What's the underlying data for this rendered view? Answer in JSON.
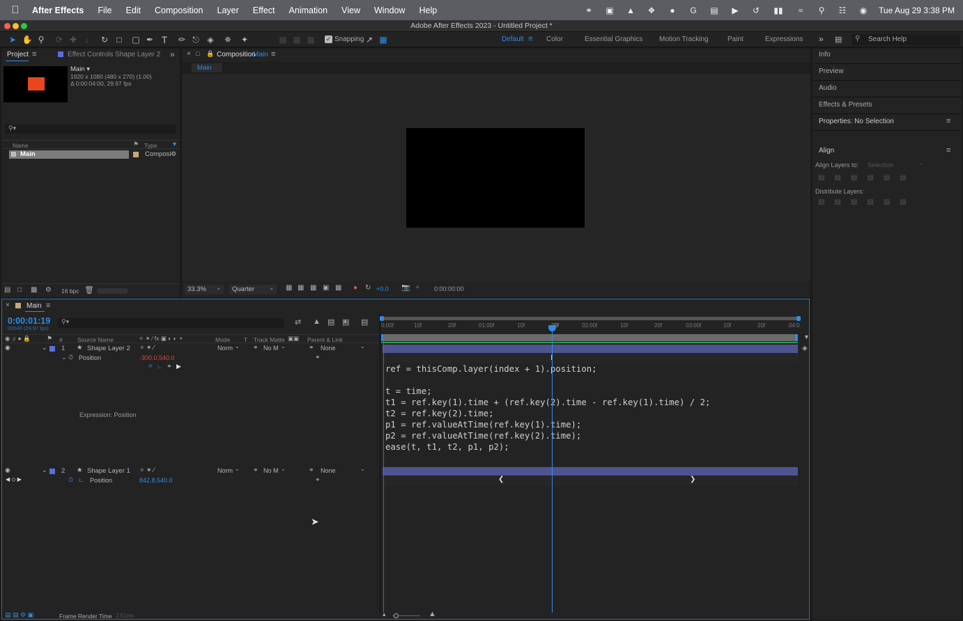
{
  "menubar": {
    "app": "After Effects",
    "items": [
      "File",
      "Edit",
      "Composition",
      "Layer",
      "Effect",
      "Animation",
      "View",
      "Window",
      "Help"
    ],
    "datetime": "Tue Aug 29  3:38 PM"
  },
  "window": {
    "title": "Adobe After Effects 2023 - Untitled Project *"
  },
  "toolbar": {
    "snapping": "Snapping",
    "workspaces": [
      "Default",
      "Color",
      "Essential Graphics",
      "Motion Tracking",
      "Paint",
      "Expressions"
    ],
    "active_workspace": "Default",
    "search_placeholder": "Search Help"
  },
  "project": {
    "tab": "Project",
    "effect_tab": "Effect Controls Shape Layer 2",
    "comp_name": "Main ▾",
    "comp_info1": "1920 x 1080  (480 x 270) (1.00)",
    "comp_info2": "Δ 0:00:04:00, 29.97 fps",
    "col_name": "Name",
    "col_type": "Type",
    "item_name": "Main",
    "item_type": "Composi",
    "bpc": "16 bpc",
    "thumb_color": "#e8471e"
  },
  "composition": {
    "tab_prefix": "Composition",
    "tab_name": "Main",
    "subtab": "Main",
    "zoom": "33.3%",
    "resolution": "Quarter",
    "exposure": "+0.0",
    "timecode": "0:00:00:00"
  },
  "right_panels": {
    "items": [
      "Info",
      "Preview",
      "Audio",
      "Effects & Presets"
    ],
    "properties": "Properties: No Selection",
    "align": "Align",
    "align_to_label": "Align Layers to:",
    "align_to_value": "Selection",
    "distribute": "Distribute Layers:"
  },
  "timeline": {
    "tab": "Main",
    "current_time": "0:00:01:19",
    "frame_info": "00049 (29.97 fps)",
    "col_num": "#",
    "col_source": "Source Name",
    "col_mode": "Mode",
    "col_t": "T",
    "col_matte": "Track Matte",
    "col_parent": "Parent & Link",
    "ruler": [
      "0:00f",
      "10f",
      "20f",
      "01:00f",
      "10f",
      "20f",
      "02:00f",
      "10f",
      "20f",
      "03:00f",
      "10f",
      "20f",
      "04:0"
    ],
    "playhead_time": "0f",
    "layers": [
      {
        "num": "1",
        "name": "Shape Layer 2",
        "mode": "Norm",
        "matte": "No M",
        "parent": "None",
        "prop": "Position",
        "value": "-300.0,540.0"
      },
      {
        "num": "2",
        "name": "Shape Layer 1",
        "mode": "Norm",
        "matte": "No M",
        "parent": "None",
        "prop": "Position",
        "value": "842.8,540.0"
      }
    ],
    "expression_label": "Expression: Position",
    "expression_lines": [
      "ref = thisComp.layer(index + 1).position;",
      "",
      "t = time;",
      "t1 = ref.key(1).time + (ref.key(2).time - ref.key(1).time) / 2;",
      "t2 = ref.key(2).time;",
      "p1 = ref.valueAtTime(ref.key(1).time);",
      "p2 = ref.valueAtTime(ref.key(2).time);",
      "ease(t, t1, t2, p1, p2);"
    ],
    "footer_label": "Frame Render Time",
    "footer_value": "2.51ms"
  }
}
